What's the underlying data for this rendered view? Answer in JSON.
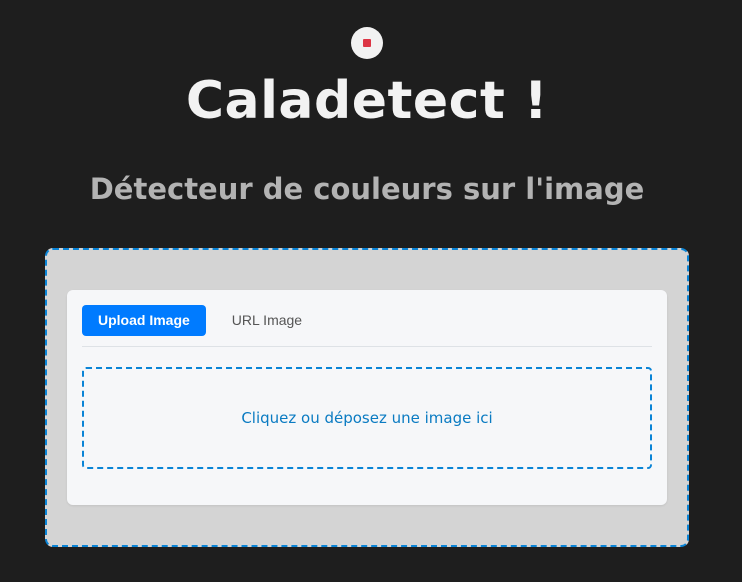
{
  "header": {
    "logo_icon": "record-icon",
    "title": "Caladetect !",
    "subtitle": "Détecteur de couleurs sur l'image"
  },
  "uploader": {
    "tabs": [
      {
        "label": "Upload Image",
        "active": true
      },
      {
        "label": "URL Image",
        "active": false
      }
    ],
    "dropzone_text": "Cliquez ou déposez une image ici"
  },
  "colors": {
    "background": "#1e1e1e",
    "accent": "#007bff",
    "dashed_border": "#0a84d6",
    "logo_dot": "#dc3545"
  }
}
